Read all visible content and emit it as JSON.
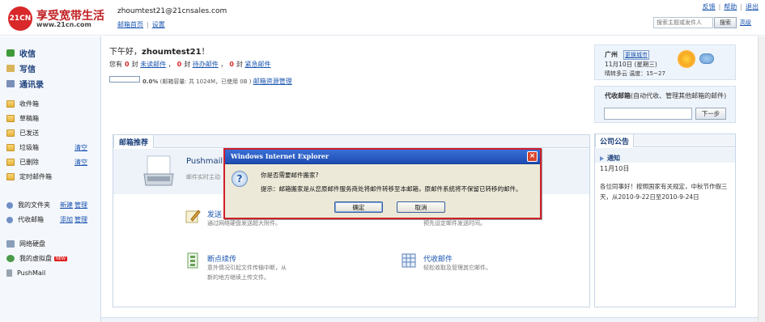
{
  "header": {
    "logo_badge": "21CN",
    "logo_title": "享受宽带生活",
    "logo_url": "www.21cn.com",
    "user_email": "zhoumtest21@21cnsales.com",
    "user_links": [
      "邮箱首页",
      "设置"
    ],
    "top_links": [
      "反馈",
      "帮助",
      "退出"
    ],
    "search_placeholder": "搜索主题或发件人",
    "search_button": "搜索",
    "advanced_search": "高级"
  },
  "sidebar": {
    "primary": [
      {
        "label": "收信",
        "icon": "inbox-download-icon"
      },
      {
        "label": "写信",
        "icon": "compose-icon"
      },
      {
        "label": "通讯录",
        "icon": "address-book-icon"
      }
    ],
    "folders": [
      {
        "label": "收件箱",
        "action": ""
      },
      {
        "label": "草稿箱",
        "action": ""
      },
      {
        "label": "已发送",
        "action": ""
      },
      {
        "label": "垃圾箱",
        "action": "清空"
      },
      {
        "label": "已删除",
        "action": "清空"
      },
      {
        "label": "定时邮件箱",
        "action": ""
      }
    ],
    "my_folders": {
      "label": "我的文件夹",
      "actions": [
        "新建",
        "管理"
      ]
    },
    "proxy_mail": {
      "label": "代收邮箱",
      "actions": [
        "添加",
        "管理"
      ]
    },
    "extras": [
      {
        "label": "网络硬盘"
      },
      {
        "label": "我的虚拟盘",
        "badge": "NEW"
      },
      {
        "label": "PushMail"
      }
    ]
  },
  "main": {
    "greeting_prefix": "下午好，",
    "greeting_user": "zhoumtest21",
    "greeting_suffix": "！",
    "counts": [
      {
        "prefix": "您有",
        "num": "0",
        "unit": "封",
        "link": "未读邮件"
      },
      {
        "prefix": "，",
        "num": "0",
        "unit": "封",
        "link": "待办邮件"
      },
      {
        "prefix": "，",
        "num": "0",
        "unit": "封",
        "link": "紧急邮件"
      }
    ],
    "capacity_percent": "0.0%",
    "capacity_text": "(邮箱容量: 共 1024M，已使用 0B )",
    "capacity_link": "邮箱资源管理",
    "capacity_fraction": 0.0
  },
  "recommend": {
    "tab": "邮箱推荐",
    "pushmail_title": "Pushmail",
    "pushmail_desc": "邮件实时主动",
    "features": [
      {
        "title": "发送",
        "desc": "通过网络硬盘发送超大附件。"
      },
      {
        "title": "",
        "desc": "预先设定邮件发送时间。"
      },
      {
        "title": "断点续传",
        "desc1": "意外情况引起文件传输中断，从",
        "desc2": "新的地方继续上传文件。"
      },
      {
        "title": "代收邮件",
        "desc": "轻松收取及管理其它邮件。"
      }
    ]
  },
  "weather": {
    "city": "广州",
    "change_city": "更换城市",
    "date": "11月10日 (星期三)",
    "desc": "晴转多云 温度：15~27"
  },
  "proxy": {
    "title_bold": "代收邮箱",
    "title_rest": "(自动代收、管理其他邮箱的邮件)",
    "button": "下一步"
  },
  "notice": {
    "tab": "公司公告",
    "label": "通知",
    "date": "11月10日",
    "body": "各位同事好！按照国家有关规定，中秋节作假三天，从2010-9-22日至2010-9-24日"
  },
  "dialog": {
    "title": "Windows Internet Explorer",
    "question": "你是否需要邮件搬家?",
    "hint": "提示：邮箱搬家是从您原邮件服务商处将邮件转移至本邮箱，原邮件系统将不保留已转移的邮件。",
    "ok": "确定",
    "cancel": "取消"
  }
}
